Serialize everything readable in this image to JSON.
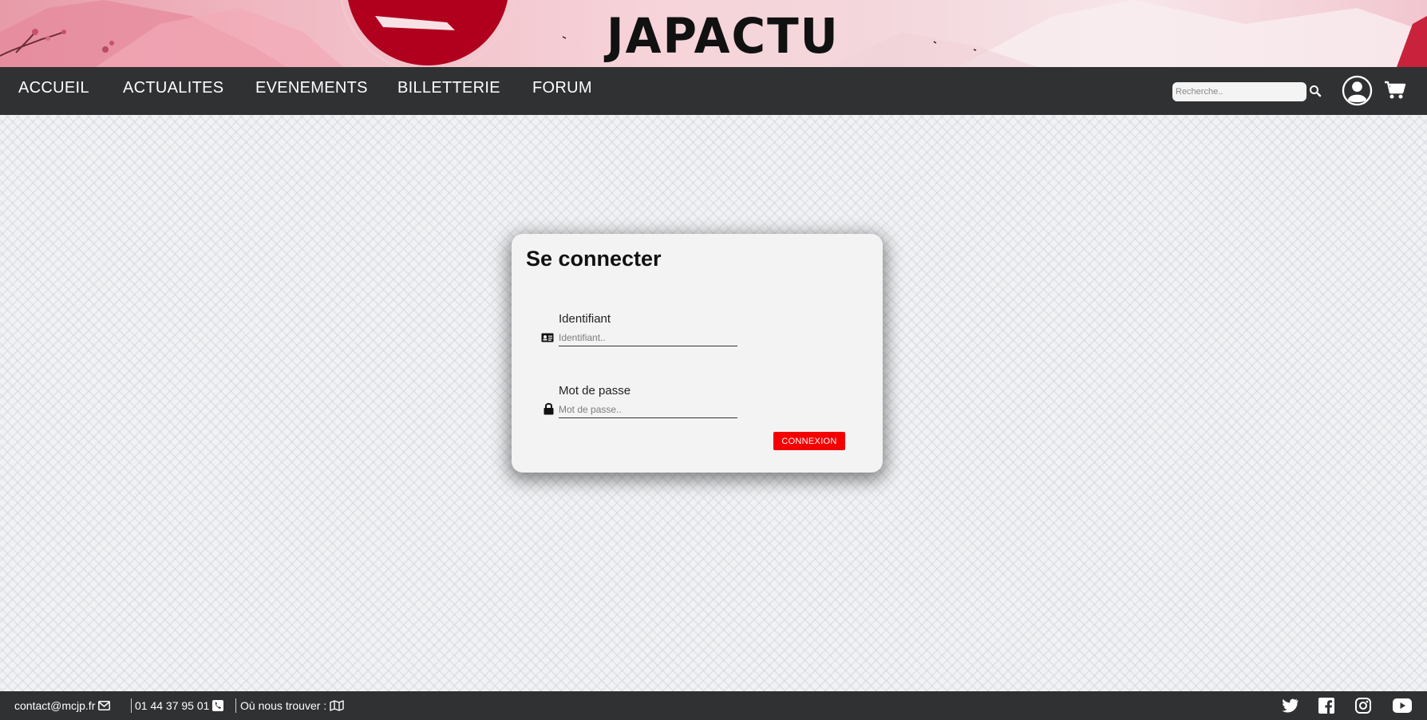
{
  "banner": {
    "logo_text": "JAPACTU",
    "colors": {
      "sun": "#b0001e",
      "pink": "#e79aa8",
      "light_pink": "#f6d3d9"
    }
  },
  "nav": {
    "items": [
      {
        "label": "ACCUEIL"
      },
      {
        "label": "ACTUALITES"
      },
      {
        "label": "EVENEMENTS"
      },
      {
        "label": "BILLETTERIE"
      },
      {
        "label": "FORUM"
      }
    ],
    "search": {
      "placeholder": "Recherche..",
      "value": ""
    },
    "icons": [
      "search-icon",
      "user-account-icon",
      "shopping-cart-icon"
    ],
    "background": "#303133"
  },
  "login": {
    "title": "Se connecter",
    "username": {
      "label": "Identifiant",
      "placeholder": "Identifiant..",
      "icon": "id-card-icon"
    },
    "password": {
      "label": "Mot de passe",
      "placeholder": "Mot de passe..",
      "icon": "lock-icon"
    },
    "submit_label": "CONNEXION",
    "accent": "#f40000"
  },
  "footer": {
    "email": "contact@mcjp.fr",
    "phone": "01 44 37 95 01",
    "location_label": "Où nous trouver :",
    "icons": [
      "envelope-icon",
      "phone-icon",
      "map-icon"
    ],
    "social": [
      "twitter-icon",
      "facebook-icon",
      "instagram-icon",
      "youtube-icon"
    ]
  }
}
